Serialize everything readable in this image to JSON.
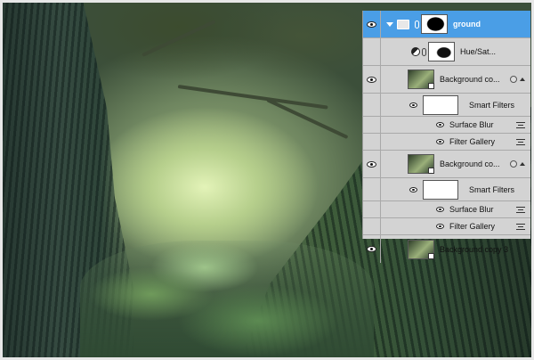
{
  "layers_panel": {
    "layers": [
      {
        "name": "ground",
        "type": "group",
        "selected": true,
        "thumb": "black-mask"
      },
      {
        "name": "Hue/Sat...",
        "type": "adjustment",
        "thumb": "hue-mask"
      },
      {
        "name": "Background co...",
        "type": "smart-object"
      },
      {
        "name": "Smart Filters",
        "type": "smart-filters"
      },
      {
        "name": "Surface Blur",
        "type": "filter"
      },
      {
        "name": "Filter Gallery",
        "type": "filter"
      },
      {
        "name": "Background co...",
        "type": "smart-object"
      },
      {
        "name": "Smart Filters",
        "type": "smart-filters"
      },
      {
        "name": "Surface Blur",
        "type": "filter"
      },
      {
        "name": "Filter Gallery",
        "type": "filter"
      },
      {
        "name": "Background copy 3",
        "type": "layer"
      }
    ]
  },
  "colors": {
    "selection": "#4a9ee6",
    "panel_bg": "#d3d3d3"
  }
}
